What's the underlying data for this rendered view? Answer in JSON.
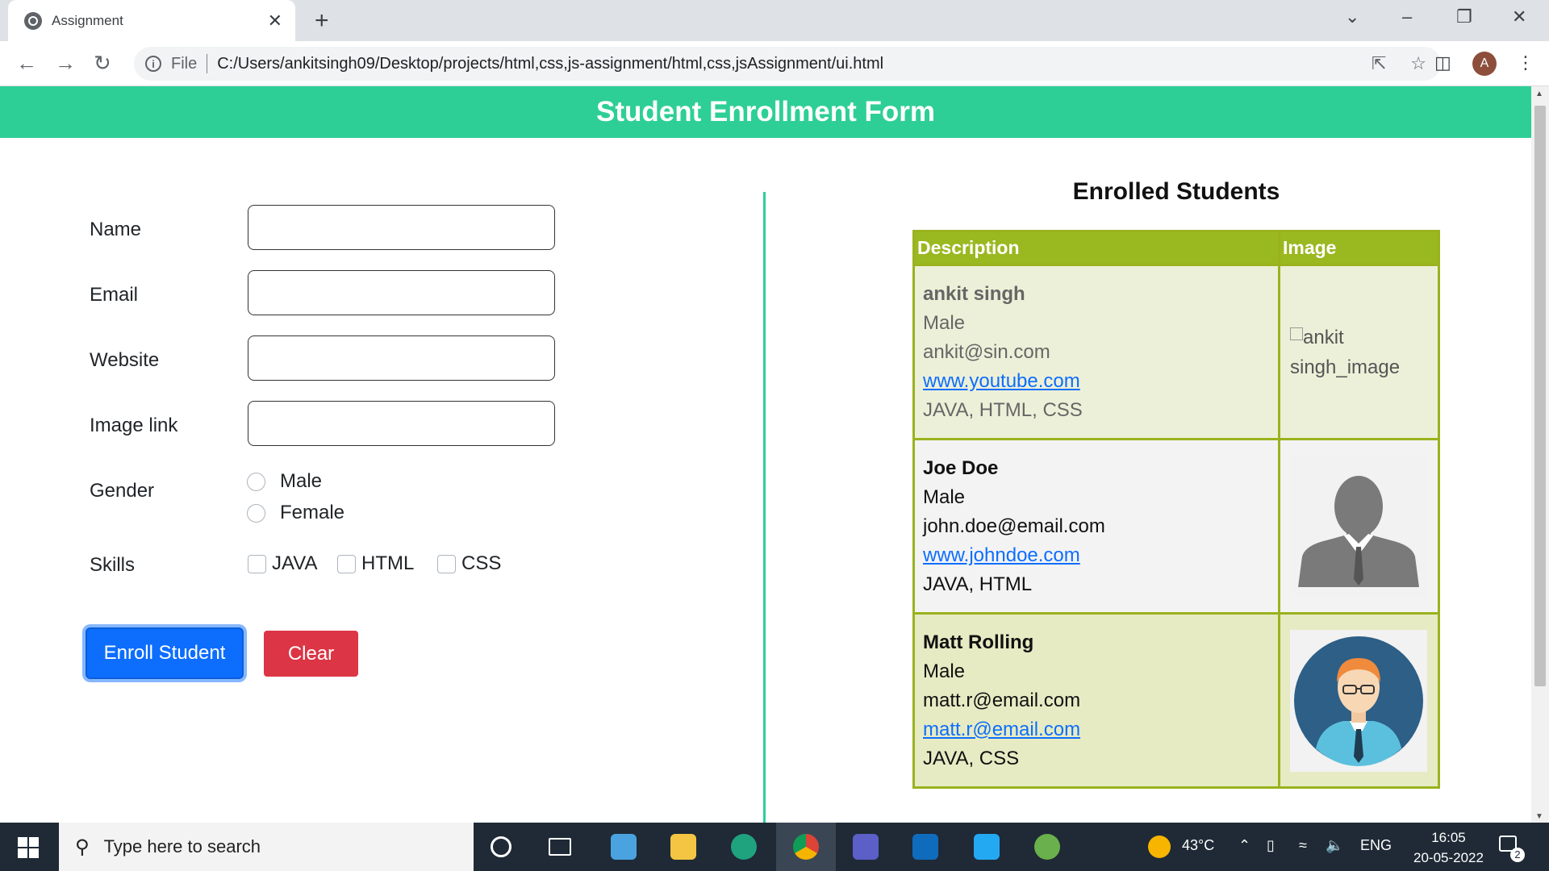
{
  "browser": {
    "tab_title": "Assignment",
    "tab_close": "✕",
    "new_tab": "+",
    "controls": {
      "tab_search": "⌄",
      "minimize": "–",
      "restore": "❐",
      "close": "✕"
    },
    "omnibox": {
      "scheme_label": "File",
      "url": "C:/Users/ankitsingh09/Desktop/projects/html,css,js-assignment/html,css,jsAssignment/ui.html"
    },
    "profile_initial": "A"
  },
  "page": {
    "header_title": "Student Enrollment Form",
    "form": {
      "labels": {
        "name": "Name",
        "email": "Email",
        "website": "Website",
        "image_link": "Image link",
        "gender": "Gender",
        "skills": "Skills"
      },
      "values": {
        "name": "",
        "email": "",
        "website": "",
        "image_link": ""
      },
      "gender_options": [
        "Male",
        "Female"
      ],
      "skill_options": [
        "JAVA",
        "HTML",
        "CSS"
      ],
      "enroll_button": "Enroll Student",
      "clear_button": "Clear"
    },
    "enrolled": {
      "title": "Enrolled Students",
      "columns": [
        "Description",
        "Image"
      ],
      "rows": [
        {
          "name": "ankit singh",
          "gender": "Male",
          "email": "ankit@sin.com",
          "website": "www.youtube.com",
          "skills": "JAVA, HTML, CSS",
          "image_alt": "ankit singh_image",
          "image": "broken"
        },
        {
          "name": "Joe Doe",
          "gender": "Male",
          "email": "john.doe@email.com",
          "website": "www.johndoe.com",
          "skills": "JAVA, HTML",
          "image": "silhouette-avatar"
        },
        {
          "name": "Matt Rolling",
          "gender": "Male",
          "email": "matt.r@email.com",
          "website": "matt.r@email.com",
          "skills": "JAVA, CSS",
          "image": "cartoon-avatar"
        }
      ]
    }
  },
  "taskbar": {
    "search_placeholder": "Type here to search",
    "weather": "43°C",
    "language": "ENG",
    "time": "16:05",
    "date": "20-05-2022",
    "notification_count": "2"
  },
  "colors": {
    "header_green": "#2ecf96",
    "table_header": "#9ab820",
    "enroll_blue": "#0d6efd",
    "clear_red": "#dc3545"
  }
}
